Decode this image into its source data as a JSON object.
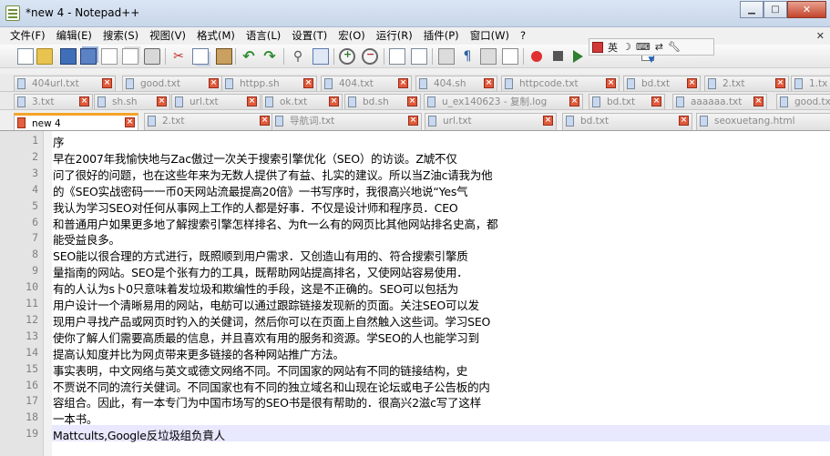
{
  "window": {
    "title": "*new  4 - Notepad++",
    "controls": {
      "minimize": "▁",
      "maximize": "□",
      "close": "✕"
    }
  },
  "menu": {
    "items": [
      "文件(F)",
      "编辑(E)",
      "搜索(S)",
      "视图(V)",
      "格式(M)",
      "语言(L)",
      "设置(T)",
      "宏(O)",
      "运行(R)",
      "插件(P)",
      "窗口(W)",
      "?"
    ],
    "close_glyph": "✕"
  },
  "ime": {
    "lang": "英",
    "icons": [
      "moon-icon",
      "keyboard-icon",
      "punct-icon",
      "wrench-icon"
    ]
  },
  "tabs": {
    "row1": [
      "404url.txt",
      "good.txt",
      "httpp.sh",
      "404.txt",
      "404.sh",
      "httpcode.txt",
      "bd.txt",
      "2.txt",
      "1.tx"
    ],
    "row2": [
      "3.txt",
      "sh.sh",
      "url.txt",
      "ok.txt",
      "bd.sh",
      "u_ex140623 - 复制.log",
      "bd.txt",
      "aaaaaa.txt",
      "good.tx"
    ],
    "row3": [
      "new  4",
      "2.txt",
      "导航词.txt",
      "url.txt",
      "bd.txt",
      "seoxuetang.html"
    ],
    "active": "new  4"
  },
  "editor": {
    "lines": [
      "序",
      "早在2007年我愉快地与Zac傲过一次关于搜索引擎优化（SEO）的访谈。Z虓不仅",
      "问了很好的问题，也在这些年来为无数人提供了有益、扎实的建议。所以当Z油c请我为他",
      "的《SEO实战密码一一币0天网站流最提高20倍》一书写序时，我很高兴地说“Yes气",
      "我认为学习SEO对任何从事网上工作的人都是好事．不仅是设计师和程序员．CEO",
      "和普通用户如果更多地了解搜索引擎怎样排名、为ft一么有的网页比其他网站排名史高，都",
      "能受益良多。",
      "SEO能以很合理的方式进行，既照顺到用户需求．又创造山有用的、符合搜索引擎质",
      "量指南的网站。SEO是个张有力的工具，既帮助网站提高排名，又使网站容易使用．",
      "有的人认为s卜0只意味着发垃圾和欺编性的手段，这是不正确的。SEO可以包括为",
      "用户设计一个清晰易用的网站，电舫可以通过跟踪链接发现新的页面。关注SEO可以发",
      "现用户寻找产品或网页时钓入的关健词，然后你可以在页面上自然触入这些词。学习SEO",
      "使你了解人们需要高质最的信息，并且喜欢有用的服务和资源。学SEO的人也能学习到",
      "提高认知度并比为网贞带来更多链接的各种网站推广方法。",
      "事实表明，中文网络与英文或德文网络不同。不同国家的网站有不同的链接结构，史",
      "不贾说不同的流行关健词。不同国家也有不同的独立域名和山现在论坛或电子公告板的内",
      "容组合。因此，有一本专门为中国市场写的SEO书是很有帮助的．很高兴2滋c写了这样",
      "一本书。",
      "Mattcults,Google反垃圾组负賁人"
    ]
  }
}
